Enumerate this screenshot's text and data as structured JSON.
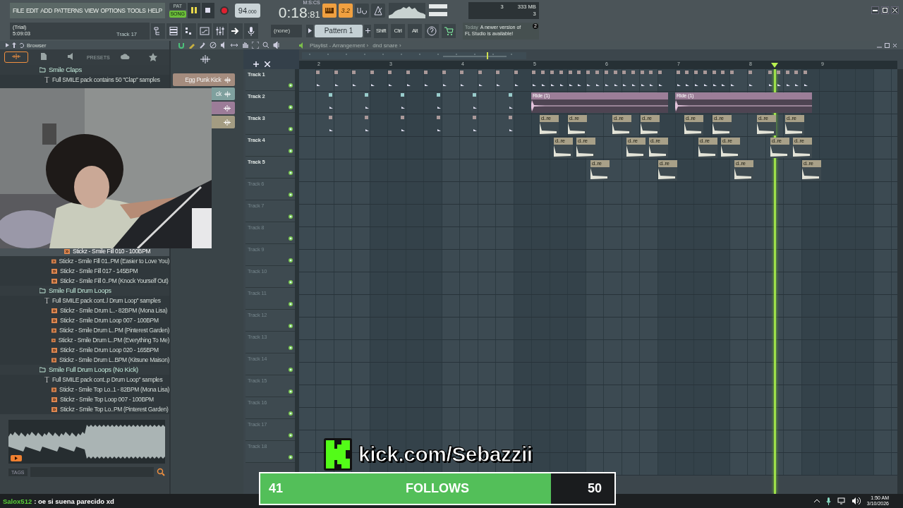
{
  "menu": [
    "FILE",
    "EDIT",
    "ADD",
    "PATTERNS",
    "VIEW",
    "OPTIONS",
    "TOOLS",
    "HELP"
  ],
  "transport": {
    "modes": [
      {
        "label": "PAT",
        "selected": false
      },
      {
        "label": "SONG",
        "selected": true
      }
    ],
    "playing": true,
    "tempo": "94",
    "tempo_fraction": ".000",
    "time": "0:18",
    "time_fraction": ":81",
    "time_unit": "M:S:CS"
  },
  "toggles": [
    {
      "kind": "step",
      "on": true
    },
    {
      "kind": "typing",
      "label": "3.2",
      "on": true
    },
    {
      "kind": "wait",
      "on": false
    },
    {
      "kind": "metronome",
      "on": false
    }
  ],
  "monitor": {
    "cpu": "3",
    "memory": "333 MB",
    "polyphony": "3"
  },
  "hint": {
    "mode": "(Trial)",
    "time": "5:09:03",
    "target": "Track 17"
  },
  "pattern_picker": "(none)",
  "pattern": "Pattern 1",
  "modifiers": [
    "Shift",
    "Ctrl",
    "Alt"
  ],
  "news": {
    "date": "Today",
    "text": "A newer version of FL Studio is available!",
    "count": "2"
  },
  "browser": {
    "title": "Browser",
    "tabs": [
      {
        "kind": "all",
        "selected": true
      },
      {
        "kind": "file",
        "selected": false
      },
      {
        "kind": "plugin",
        "selected": false
      },
      {
        "kind": "text",
        "label": "PRESETS",
        "selected": false
      },
      {
        "kind": "cloud",
        "selected": false
      },
      {
        "kind": "star",
        "selected": false
      }
    ],
    "items": [
      {
        "kind": "folder",
        "label": "Smile Claps",
        "children": [
          {
            "kind": "info",
            "label": "Full SMILE pack contains 50 ''Clap'' samples",
            "selected": false
          }
        ]
      },
      {
        "kind": "audio",
        "label": "Stickz - Smile Fill 010 - 100BPM",
        "selected": true
      },
      {
        "kind": "audio",
        "label": "Stickz - Smile Fill 01..PM (Easier to Love You)",
        "selected": false
      },
      {
        "kind": "audio",
        "label": "Stickz - Smile Fill 017 - 145BPM",
        "selected": false
      },
      {
        "kind": "audio",
        "label": "Stickz - Smile Fill 0..PM (Knock Yourself Out)",
        "selected": false
      },
      {
        "kind": "folder",
        "label": "Smile Full Drum Loops",
        "children": [
          {
            "kind": "info",
            "label": "Full SMILE pack cont..l Drum Loop'' samples",
            "selected": false
          },
          {
            "kind": "audio",
            "label": "Stickz - Smile Drum L..- 82BPM (Mona Lisa)",
            "selected": false
          },
          {
            "kind": "audio",
            "label": "Stickz - Smile Drum Loop 007 - 100BPM",
            "selected": false
          },
          {
            "kind": "audio",
            "label": "Stickz - Smile Drum L..PM (Pinterest Garden)",
            "selected": false
          },
          {
            "kind": "audio",
            "label": "Stickz - Smile Drum L..PM (Everything To Me)",
            "selected": false
          },
          {
            "kind": "audio",
            "label": "Stickz - Smile Drum Loop 020 - 165BPM",
            "selected": false
          },
          {
            "kind": "audio",
            "label": "Stickz - Smile Drum L..BPM (Kitsune Maison)",
            "selected": false
          }
        ]
      },
      {
        "kind": "folder",
        "label": "Smile Full Drum Loops (No Kick)",
        "children": [
          {
            "kind": "info",
            "label": "Full SMILE pack cont..p Drum Loop'' samples",
            "selected": false
          },
          {
            "kind": "audio",
            "label": "Stickz - Smile Top Lo..1 - 82BPM (Mona Lisa)",
            "selected": false
          },
          {
            "kind": "audio",
            "label": "Stickz - Smile Top Loop 007 - 100BPM",
            "selected": false
          },
          {
            "kind": "audio",
            "label": "Stickz - Smile Top Lo..PM (Pinterest Garden)",
            "selected": false
          }
        ]
      }
    ],
    "tags_label": "TAGS"
  },
  "channel_rack": {
    "channels": [
      {
        "name": "Egg Punk Kick",
        "color": "#a48c7e"
      },
      {
        "name": "ck",
        "color": "#7fa09e"
      },
      {
        "color": "#9c7c98"
      },
      {
        "color": "#a39c82"
      }
    ]
  },
  "playlist": {
    "title": "Playlist - Arrangement ›",
    "pattern": "dnd snare ›",
    "ruler": [
      "2",
      "3",
      "4",
      "5",
      "6",
      "7",
      "8",
      "9"
    ],
    "tracks": [
      {
        "name": "Track 1",
        "active": true
      },
      {
        "name": "Track 2",
        "active": true,
        "clips": [
          "Ride (1)",
          "Ride (1)"
        ]
      },
      {
        "name": "Track 3",
        "active": true,
        "clips": [
          "d..re",
          "d..re",
          "d..re",
          "d..re",
          "d..re",
          "d..re",
          "d..re",
          "d..re"
        ]
      },
      {
        "name": "Track 4",
        "active": true,
        "clips": [
          "d..re",
          "d..re",
          "d..re",
          "d..re",
          "d..re",
          "d..re",
          "d..re",
          "d..re"
        ]
      },
      {
        "name": "Track 5",
        "active": true,
        "clips": [
          "d..re",
          "d..re",
          "d..re",
          "d..re"
        ]
      },
      {
        "name": "Track 6",
        "active": false
      },
      {
        "name": "Track 7",
        "active": false
      },
      {
        "name": "Track 8",
        "active": false
      },
      {
        "name": "Track 9",
        "active": false
      },
      {
        "name": "Track 10",
        "active": false
      },
      {
        "name": "Track 11",
        "active": false
      },
      {
        "name": "Track 12",
        "active": false
      },
      {
        "name": "Track 13",
        "active": false
      },
      {
        "name": "Track 14",
        "active": false
      },
      {
        "name": "Track 15",
        "active": false
      },
      {
        "name": "Track 16",
        "active": false
      },
      {
        "name": "Track 17",
        "active": false
      },
      {
        "name": "Track 18",
        "active": false
      }
    ]
  },
  "stream": {
    "channel": "kick.com/Sebazzii",
    "follows": {
      "current": "41",
      "label": "FOLLOWS",
      "goal": "50",
      "level": 0.82
    }
  },
  "chat": {
    "user": "Salox512",
    "message": ": oe si suena parecido xd"
  },
  "clock": {
    "time": "1:50 AM",
    "date": "3/10/2026"
  }
}
